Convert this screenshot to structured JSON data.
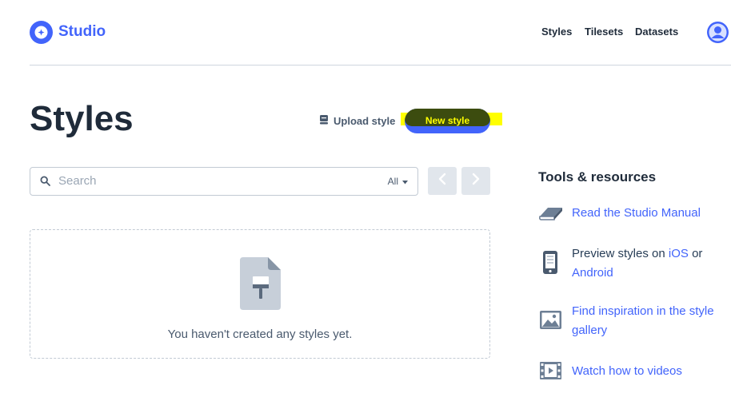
{
  "header": {
    "logo_text": "Studio",
    "nav": [
      "Styles",
      "Tilesets",
      "Datasets"
    ]
  },
  "page": {
    "title": "Styles",
    "upload_label": "Upload style",
    "new_style_label": "New style"
  },
  "search": {
    "placeholder": "Search",
    "filter_value": "All"
  },
  "empty_state": {
    "message": "You haven't created any styles yet."
  },
  "sidebar": {
    "heading": "Tools & resources",
    "manual_link": "Read the Studio Manual",
    "preview_prefix": "Preview styles on ",
    "preview_ios": "iOS",
    "preview_or": " or",
    "preview_android": "Android",
    "inspiration_link": "Find inspiration in the style gallery",
    "videos_link": "Watch how to videos"
  },
  "colors": {
    "brand": "#4264fb",
    "highlight": "#ffff00",
    "text_dark": "#1f2b3a"
  },
  "icons": [
    "studio-logo-icon",
    "avatar-icon",
    "upload-icon",
    "search-icon",
    "chevron-down-icon",
    "chevron-left-icon",
    "chevron-right-icon",
    "paintbrush-file-icon",
    "book-icon",
    "phone-icon",
    "image-icon",
    "film-icon"
  ]
}
